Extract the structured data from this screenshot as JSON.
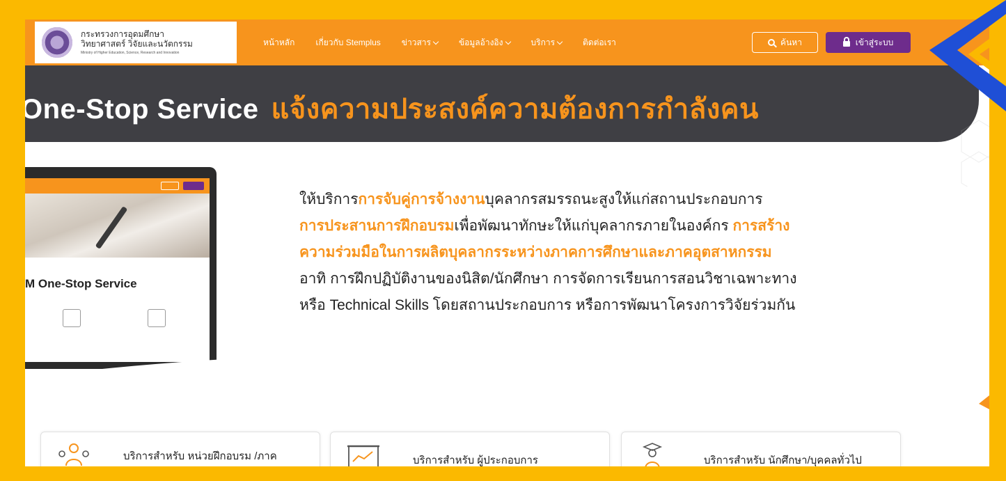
{
  "header": {
    "logo_line1": "กระทรวงการอุดมศึกษา",
    "logo_line2": "วิทยาศาสตร์ วิจัยและนวัตกรรม",
    "logo_line3": "Ministry of Higher Education, Science, Research and Innovation",
    "nav": [
      {
        "label": "หน้าหลัก",
        "dropdown": false
      },
      {
        "label": "เกี่ยวกับ Stemplus",
        "dropdown": false
      },
      {
        "label": "ข่าวสาร",
        "dropdown": true
      },
      {
        "label": "ข้อมูลอ้างอิง",
        "dropdown": true
      },
      {
        "label": "บริการ",
        "dropdown": true
      },
      {
        "label": "ติดต่อเรา",
        "dropdown": false
      }
    ],
    "search_label": "ค้นหา",
    "login_label": "เข้าสู่ระบบ"
  },
  "banner": {
    "title_en": "One-Stop Service",
    "title_th": "แจ้งความประสงค์ความต้องการกำลังคน"
  },
  "laptop": {
    "title": "M One-Stop Service"
  },
  "description": {
    "line1_a": "ให้บริการ",
    "line1_hl": "การจับคู่การจ้างงาน",
    "line1_b": "บุคลากรสมรรถนะสูงให้แก่สถานประกอบการ",
    "line2_hl": "การประสานการฝึกอบรม",
    "line2_a": "เพื่อพัฒนาทักษะให้แก่บุคลากรภายในองค์กร ",
    "line2_hl2": "การสร้าง",
    "line3_hl": "ความร่วมมือในการผลิตบุคลากรระหว่างภาคการศึกษาและภาคอุตสาหกรรม",
    "line4": "อาทิ การฝึกปฏิบัติงานของนิสิต/นักศึกษา การจัดการเรียนการสอนวิชาเฉพาะทาง",
    "line5": "หรือ Technical Skills โดยสถานประกอบการ หรือการพัฒนาโครงการวิจัยร่วมกัน"
  },
  "cards": [
    {
      "label": "บริการสำหรับ หน่วยฝึกอบรม /ภาค",
      "icon": "people-group-icon"
    },
    {
      "label": "บริการสำหรับ ผู้ประกอบการ",
      "icon": "chart-board-icon"
    },
    {
      "label": "บริการสำหรับ นักศึกษา/บุคคลทั่วไป",
      "icon": "graduate-icon"
    }
  ],
  "colors": {
    "frame": "#fbb900",
    "header": "#f7941d",
    "login": "#6e2c8c",
    "banner": "#3f3f44",
    "accent_blue": "#1f4fd6"
  }
}
